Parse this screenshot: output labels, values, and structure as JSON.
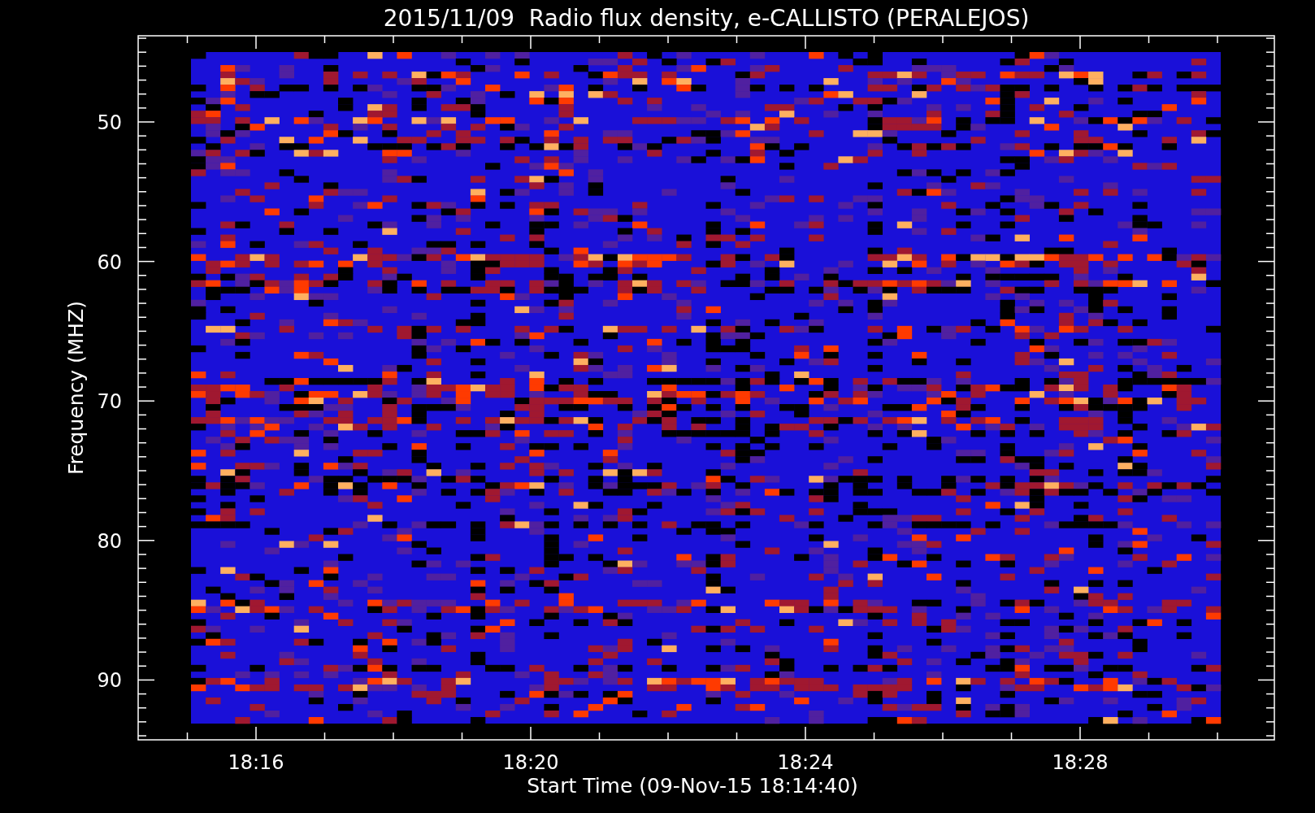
{
  "title": "2015/11/09  Radio flux density, e-CALLISTO (PERALEJOS)",
  "ylabel": "Frequency (MHZ)",
  "xlabel": "Start Time (09-Nov-15 18:14:40)",
  "yticks": [
    "50",
    "60",
    "70",
    "80",
    "90"
  ],
  "xticks": [
    "18:16",
    "18:20",
    "18:24",
    "18:28"
  ]
}
